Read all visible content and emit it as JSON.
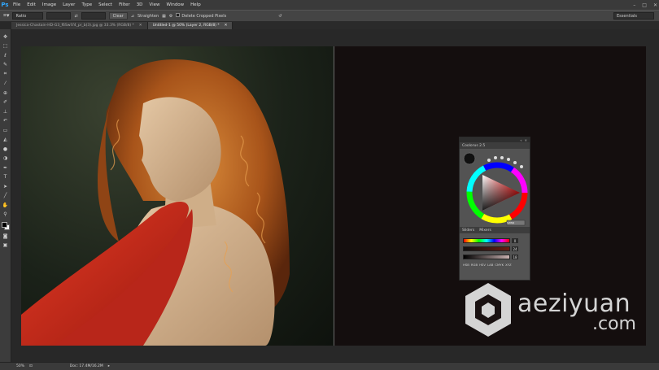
{
  "app": {
    "logo": "Ps"
  },
  "menu": [
    "File",
    "Edit",
    "Image",
    "Layer",
    "Type",
    "Select",
    "Filter",
    "3D",
    "View",
    "Window",
    "Help"
  ],
  "window_controls": [
    "–",
    "□",
    "✕"
  ],
  "options": {
    "ratio": "Ratio",
    "clear": "Clear",
    "straighten": "Straighten",
    "delete_cropped": "Delete Cropped Pixels",
    "workspace": "Essentials"
  },
  "tabs": [
    {
      "label": "Jessica-Chastain-HD-G3_f6Swf.f4_pr_b(3).jpg @ 33.3% (RGB/8) *",
      "active": false
    },
    {
      "label": "Untitled-1 @ 50% (Layer 2, RGB/8) *",
      "active": true
    }
  ],
  "coolorus": {
    "title": "Coolorus 2.5",
    "tab_sliders": "Sliders",
    "tab_mixers": "Mixers",
    "values": [
      "0",
      "24",
      "18"
    ],
    "modes": [
      "HSB",
      "RGB",
      "HSV",
      "LAB",
      "CMYK",
      "XYZ"
    ],
    "btn": "swap"
  },
  "status": {
    "zoom": "50%",
    "doc": "Doc: 17.4M/16.2M"
  },
  "watermark": {
    "line1": "aeziyuan",
    "line2": ".com"
  },
  "colors": {
    "accent": "#31a8ff",
    "drape": "#c4291e",
    "hair": "#b8621c"
  }
}
